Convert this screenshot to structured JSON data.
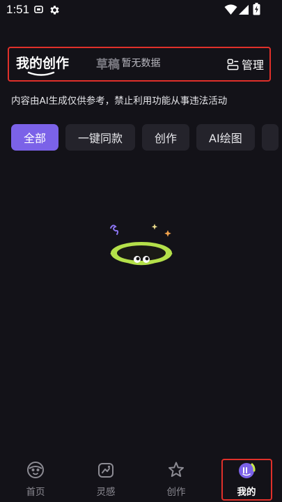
{
  "status_bar": {
    "time": "1:51",
    "icons": [
      "notification-icon",
      "settings-gear-icon",
      "wifi-icon",
      "signal-icon",
      "battery-icon"
    ]
  },
  "header": {
    "tabs": [
      {
        "label": "我的创作",
        "active": true
      },
      {
        "label": "草稿",
        "active": false
      }
    ],
    "manage_label": "管理"
  },
  "disclaimer": "内容由AI生成仅供参考，禁止利用功能从事违法活动",
  "filters": [
    {
      "label": "全部",
      "active": true
    },
    {
      "label": "一键同款",
      "active": false
    },
    {
      "label": "创作",
      "active": false
    },
    {
      "label": "AI绘图",
      "active": false
    },
    {
      "label": "",
      "active": false
    }
  ],
  "empty_state": {
    "text": "暂无数据"
  },
  "bottom_nav": [
    {
      "label": "首页",
      "icon": "home-face-icon",
      "active": false
    },
    {
      "label": "灵感",
      "icon": "inspiration-icon",
      "active": false
    },
    {
      "label": "创作",
      "icon": "create-star-icon",
      "active": false
    },
    {
      "label": "我的",
      "icon": "profile-avatar-icon",
      "active": true
    }
  ],
  "colors": {
    "background": "#131218",
    "accent": "#7b62e8",
    "highlight_border": "#e0302a"
  }
}
